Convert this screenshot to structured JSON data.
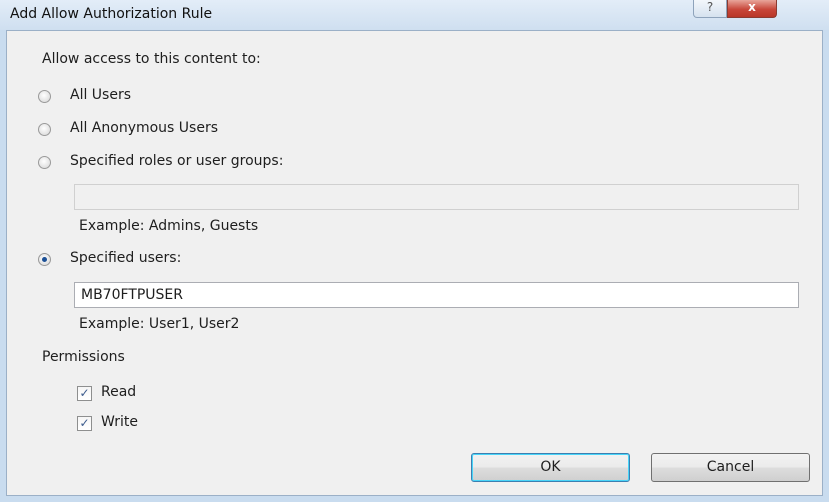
{
  "dialog": {
    "title": "Add Allow Authorization Rule",
    "help_glyph": "?",
    "close_glyph": "x"
  },
  "access": {
    "heading": "Allow access to this content to:",
    "options": [
      {
        "label": "All Users",
        "selected": false
      },
      {
        "label": "All Anonymous Users",
        "selected": false
      },
      {
        "label": "Specified roles or user groups:",
        "selected": false
      },
      {
        "label": "Specified users:",
        "selected": true
      }
    ],
    "roles_value": "",
    "roles_example": "Example: Admins, Guests",
    "users_value": "MB70FTPUSER",
    "users_example": "Example: User1, User2"
  },
  "permissions": {
    "heading": "Permissions",
    "items": [
      {
        "label": "Read",
        "checked": true
      },
      {
        "label": "Write",
        "checked": true
      }
    ],
    "check_glyph": "✓"
  },
  "buttons": {
    "ok": "OK",
    "cancel": "Cancel"
  }
}
